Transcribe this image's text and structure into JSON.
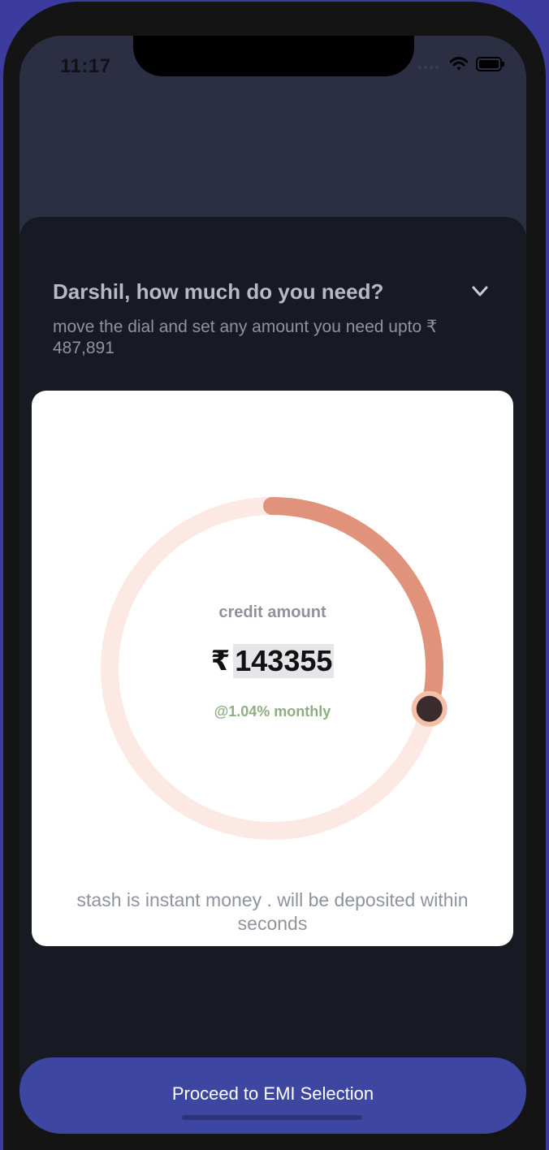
{
  "status_bar": {
    "time": "11:17"
  },
  "header": {
    "question": "Darshil, how much do you need?",
    "subtitle": "move the dial and set any amount you need upto ₹ 487,891"
  },
  "dial_card": {
    "label": "credit amount",
    "currency_symbol": "₹",
    "amount": "143355",
    "rate": "@1.04% monthly",
    "footnote": "stash is instant money . will be deposited within seconds",
    "dial_fraction": 0.29,
    "colors": {
      "track": "#fce9e3",
      "progress": "#e0927a",
      "knob": "#3a2c2c",
      "knob_ring": "#f6bfa8"
    }
  },
  "footer": {
    "proceed_label": "Proceed to EMI Selection"
  },
  "icons": {
    "signal": "signal-icon",
    "wifi": "wifi-icon",
    "battery": "battery-icon",
    "chevron": "chevron-down-icon"
  }
}
